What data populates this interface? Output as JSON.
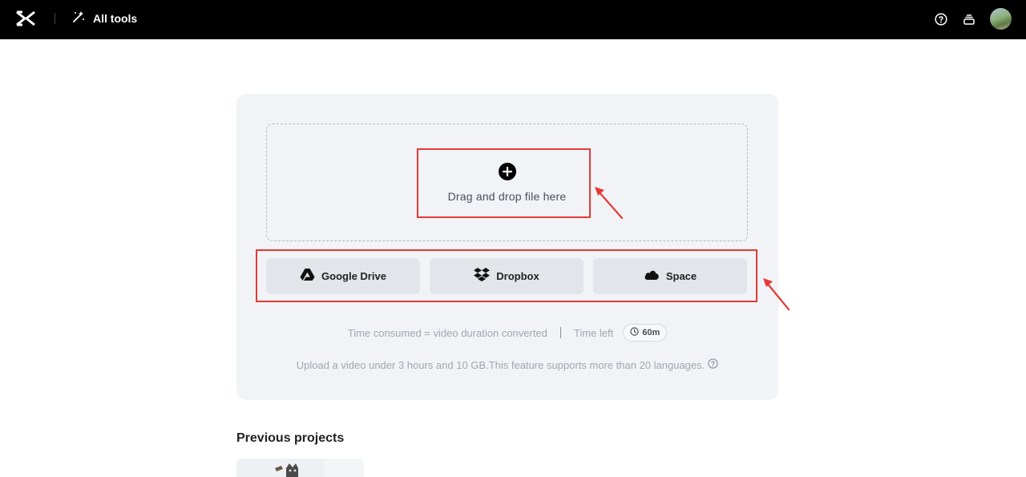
{
  "topbar": {
    "all_tools_label": "All tools",
    "icons": [
      "capcut-logo-icon",
      "magic-wand-icon",
      "help-icon",
      "stack-icon",
      "avatar"
    ]
  },
  "upload": {
    "drop_text": "Drag and drop file here",
    "sources": [
      {
        "label": "Google Drive",
        "icon": "google-drive-icon"
      },
      {
        "label": "Dropbox",
        "icon": "dropbox-icon"
      },
      {
        "label": "Space",
        "icon": "cloud-icon"
      }
    ],
    "time_consumed_text": "Time consumed = video duration converted",
    "time_left_label": "Time left",
    "time_left_value": "60m",
    "upload_note": "Upload a video under 3 hours and 10 GB.This feature supports more than 20 languages."
  },
  "previous_projects": {
    "title": "Previous projects"
  },
  "colors": {
    "topbar": "#000000",
    "card": "#f1f3f6",
    "source_button": "#e2e6ea",
    "annotation": "#e53935"
  }
}
